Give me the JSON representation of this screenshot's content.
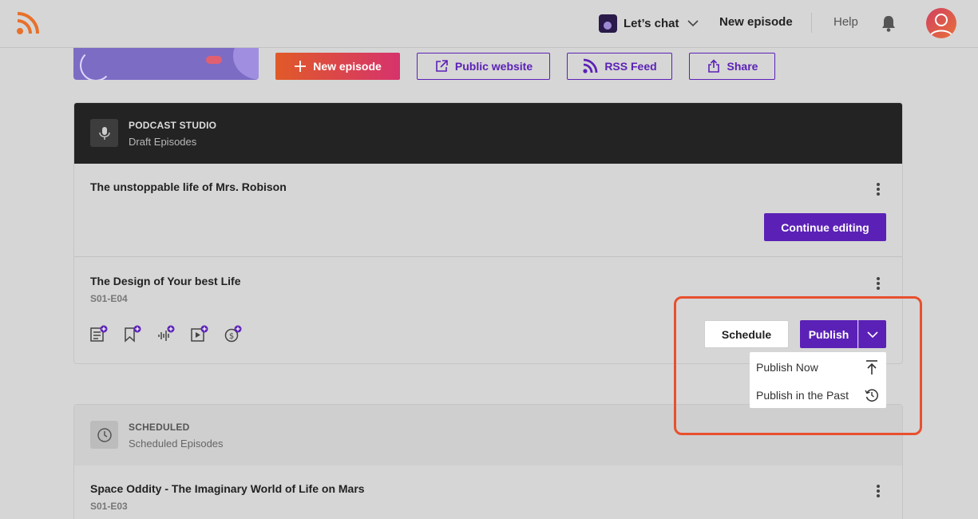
{
  "header": {
    "podcast_name": "Let’s chat",
    "new_episode": "New episode",
    "help": "Help"
  },
  "actions": {
    "new_episode": "New episode",
    "public_website": "Public website",
    "rss_feed": "RSS Feed",
    "share": "Share"
  },
  "drafts": {
    "title": "PODCAST STUDIO",
    "subtitle": "Draft Episodes",
    "episodes": [
      {
        "title": "The unstoppable life of Mrs. Robison",
        "action": "Continue editing"
      },
      {
        "title": "The Design of Your best Life",
        "code": "S01-E04"
      }
    ]
  },
  "publish": {
    "schedule": "Schedule",
    "publish": "Publish",
    "menu": [
      "Publish Now",
      "Publish in the Past"
    ]
  },
  "scheduled": {
    "title": "SCHEDULED",
    "subtitle": "Scheduled Episodes",
    "episodes": [
      {
        "title": "Space Oddity - The Imaginary World of Life on Mars",
        "code": "S01-E03"
      }
    ]
  },
  "colors": {
    "accent": "#5b21b6",
    "brand_orange": "#e8702a",
    "highlight": "#e8502e"
  }
}
